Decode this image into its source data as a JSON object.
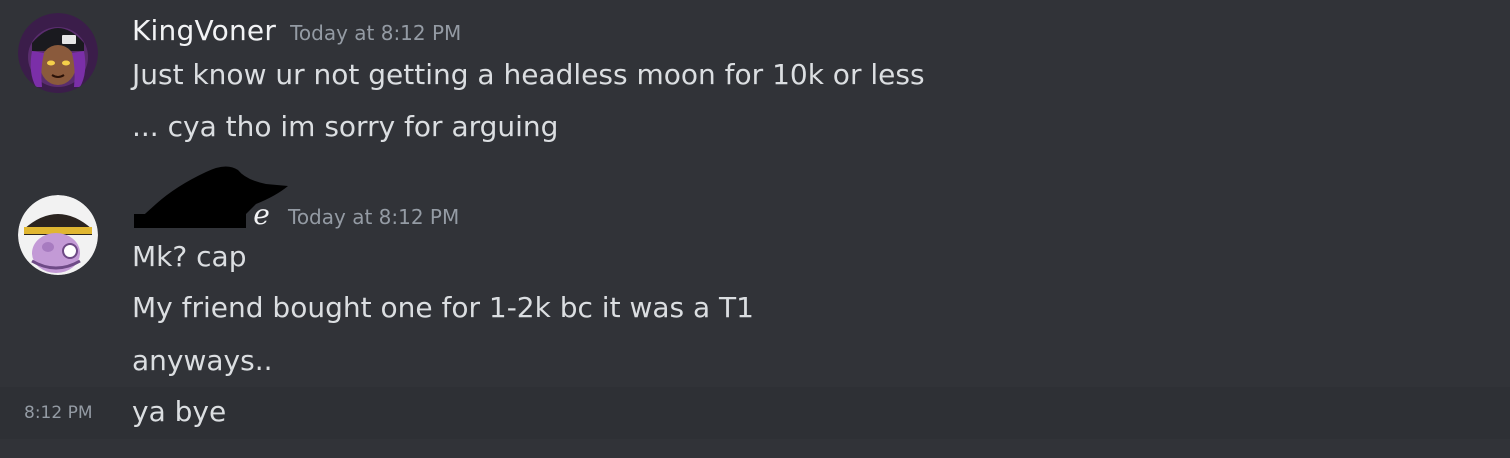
{
  "messages": [
    {
      "username": "KingVoner",
      "timestamp": "Today at 8:12 PM",
      "lines": [
        "Just know ur not getting a headless moon for 10k or less",
        "... cya tho im sorry for arguing"
      ],
      "avatar_icon": "purple-character-avatar"
    },
    {
      "username_visible_fragment": "e",
      "timestamp": "Today at 8:12 PM",
      "lines": [
        "Mk? cap",
        "My friend bought one for 1-2k bc it was a T1",
        "anyways.."
      ],
      "avatar_icon": "helmet-character-avatar"
    }
  ],
  "continued_message": {
    "time": "8:12 PM",
    "text": "ya bye"
  },
  "colors": {
    "background": "#313338",
    "hover_background": "#2e3035",
    "username": "#f2f3f5",
    "text": "#dbdee1",
    "timestamp": "#949ba4"
  }
}
